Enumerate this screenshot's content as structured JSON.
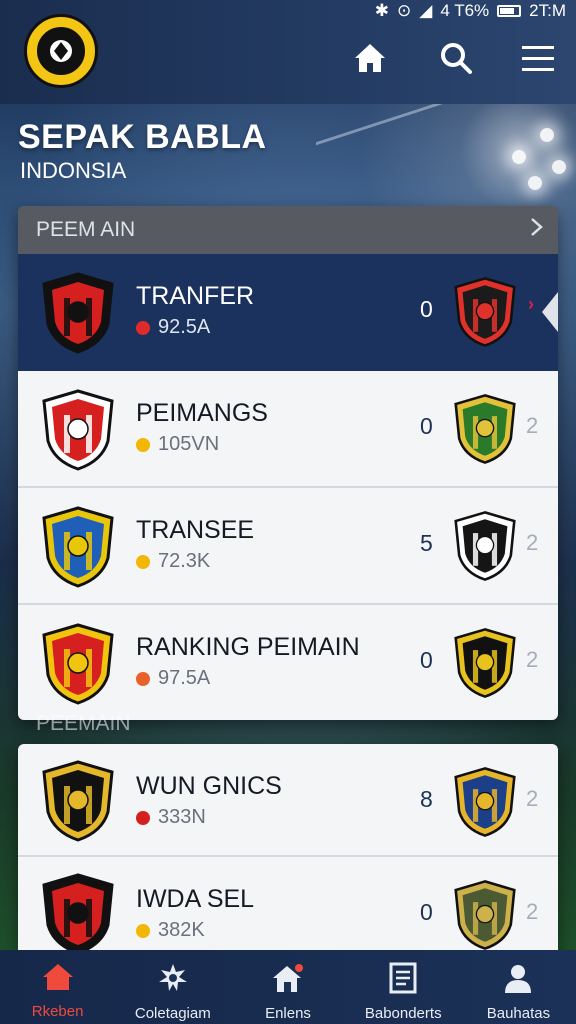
{
  "status_bar": {
    "icons": [
      "bluetooth-icon",
      "alarm-icon",
      "signal-icon"
    ],
    "text": "4 T6%",
    "time": "2T:M"
  },
  "header": {
    "logo": "club-logo",
    "icons": [
      "home-icon",
      "search-icon",
      "menu-icon"
    ]
  },
  "hero": {
    "title": "SEPAK BABLA",
    "subtitle": "INDONSIA"
  },
  "card": {
    "header_label": "PEEM AIN",
    "rows": [
      {
        "name": "TRANFER",
        "sub": "92.5A",
        "score": "0",
        "extra": "",
        "active": true,
        "dot_color": "#e02b2b",
        "left_colors": [
          "#d62020",
          "#111111"
        ],
        "right_colors": [
          "#1b1b1b",
          "#e0322b"
        ]
      },
      {
        "name": "PEIMANGS",
        "sub": "105VN",
        "score": "0",
        "extra": "2",
        "active": false,
        "dot_color": "#f2b705",
        "left_colors": [
          "#d62020",
          "#ffffff"
        ],
        "right_colors": [
          "#2a7a2a",
          "#e3c23a"
        ]
      },
      {
        "name": "TRANSEE",
        "sub": "72.3K",
        "score": "5",
        "extra": "2",
        "active": false,
        "dot_color": "#f2b705",
        "left_colors": [
          "#1f5fb8",
          "#e8c70a"
        ],
        "right_colors": [
          "#151515",
          "#ffffff"
        ]
      },
      {
        "name": "RANKING PEIMAIN",
        "sub": "97.5A",
        "score": "0",
        "extra": "2",
        "active": false,
        "dot_color": "#e8612b",
        "left_colors": [
          "#d62020",
          "#f1c40f"
        ],
        "right_colors": [
          "#111111",
          "#e9c31d"
        ]
      }
    ]
  },
  "section2": {
    "label": "PEEMAIN",
    "rows": [
      {
        "name": "WUN GNICS",
        "sub": "333N",
        "score": "8",
        "extra": "2",
        "active": false,
        "dot_color": "#d62020",
        "left_colors": [
          "#111111",
          "#e4b82a"
        ],
        "right_colors": [
          "#1c3f8a",
          "#e7b52a"
        ]
      },
      {
        "name": "IWDA SEL",
        "sub": "382K",
        "score": "0",
        "extra": "2",
        "active": false,
        "dot_color": "#f2b705",
        "left_colors": [
          "#d62020",
          "#111111"
        ],
        "right_colors": [
          "#4c5a33",
          "#cdb14a"
        ]
      }
    ]
  },
  "bottom_nav": [
    {
      "label": "Rkeben",
      "icon": "home-icon",
      "active": true
    },
    {
      "label": "Coletagiam",
      "icon": "gear-icon",
      "active": false
    },
    {
      "label": "Enlens",
      "icon": "house-alert-icon",
      "active": false
    },
    {
      "label": "Babonderts",
      "icon": "document-icon",
      "active": false
    },
    {
      "label": "Bauhatas",
      "icon": "person-icon",
      "active": false
    }
  ]
}
